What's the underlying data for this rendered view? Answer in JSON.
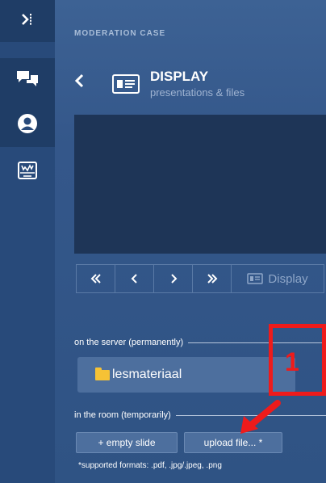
{
  "sidebar": {
    "toggle_icon": "collapse-right-icon",
    "items": [
      {
        "icon": "chat-icon"
      },
      {
        "icon": "user-icon"
      },
      {
        "icon": "inbox-icon"
      }
    ]
  },
  "panel": {
    "title": "MODERATION CASE",
    "display": {
      "title": "DISPLAY",
      "subtitle": "presentations & files"
    },
    "controls": {
      "first_symbol": "«",
      "prev_symbol": "‹",
      "next_symbol": "›",
      "last_symbol": "»",
      "display_label": "Display"
    },
    "server_section": {
      "label": "on the server (permanently)",
      "folder": "lesmateriaal"
    },
    "room_section": {
      "label": "in the room (temporarily)",
      "empty_slide_button": "+ empty slide",
      "upload_button": "upload file... *",
      "formats_note": "*supported formats: .pdf, .jpg/.jpeg, .png"
    }
  },
  "annotation": {
    "number": "1",
    "color": "#ee1b1b"
  },
  "colors": {
    "sidebar": "#284a7a",
    "panel": "#34578a",
    "screen": "#1e3557",
    "folder": "#f6c235"
  }
}
